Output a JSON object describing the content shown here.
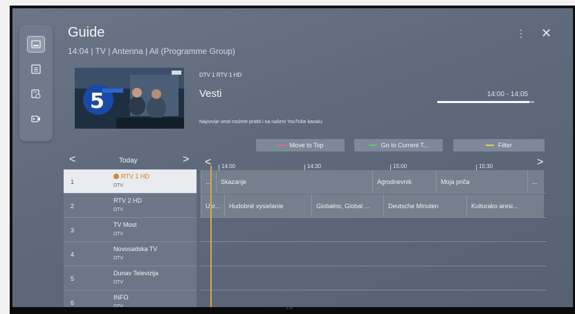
{
  "header": {
    "title": "Guide",
    "subtitle": "14:04 | TV | Antenna | All (Programme Group)",
    "more_icon": "⋮",
    "close_icon": "✕"
  },
  "rail": {
    "items": [
      {
        "icon": "guide-icon",
        "active": true
      },
      {
        "icon": "list-icon",
        "active": false
      },
      {
        "icon": "schedule-icon",
        "active": false
      },
      {
        "icon": "recording-icon",
        "active": false
      }
    ]
  },
  "preview": {
    "channel": "DTV  1  RTV 1 HD",
    "program_title": "Vesti",
    "time_range": "14:00 - 14:05",
    "progress": 0.95,
    "description": "Najnovije vesti možete pratiti i na našem YouTube kanalu."
  },
  "buttons": {
    "move_to_top": "Move to Top",
    "go_to_current": "Go to Current T...",
    "filter": "Filter"
  },
  "colors": {
    "red_key": "#d96a8a",
    "green_key": "#6cc56c",
    "yellow_key": "#e2d24a",
    "now_line": "#e5a53b"
  },
  "day_nav": {
    "label": "Today",
    "prev": "<",
    "next": ">"
  },
  "timeline": {
    "prev": "<",
    "next": ">",
    "times": [
      "14:00",
      "14:30",
      "15:00",
      "15:30"
    ]
  },
  "channels": [
    {
      "number": "1",
      "name": "RTV 1 HD",
      "type": "DTV",
      "selected": true,
      "favorite": true
    },
    {
      "number": "2",
      "name": "RTV 2 HD",
      "type": "DTV",
      "selected": false,
      "favorite": false
    },
    {
      "number": "3",
      "name": "TV Most",
      "type": "DTV",
      "selected": false,
      "favorite": false
    },
    {
      "number": "4",
      "name": "Novosadska TV",
      "type": "DTV",
      "selected": false,
      "favorite": false
    },
    {
      "number": "5",
      "name": "Dunav Televizija",
      "type": "DTV",
      "selected": false,
      "favorite": false
    },
    {
      "number": "6",
      "name": "INFO",
      "type": "DTV",
      "selected": false,
      "favorite": false
    }
  ],
  "programs": {
    "row1": [
      "...",
      "Skazanje",
      "Agrodnevnik",
      "Moja priča",
      "..."
    ],
    "row2": [
      "Ukr...",
      "Hudobné vysielanie",
      "Globalno, Global ...",
      "Deutsche Minuten",
      "Kulturako aresi..."
    ]
  },
  "chin_label": "LG"
}
